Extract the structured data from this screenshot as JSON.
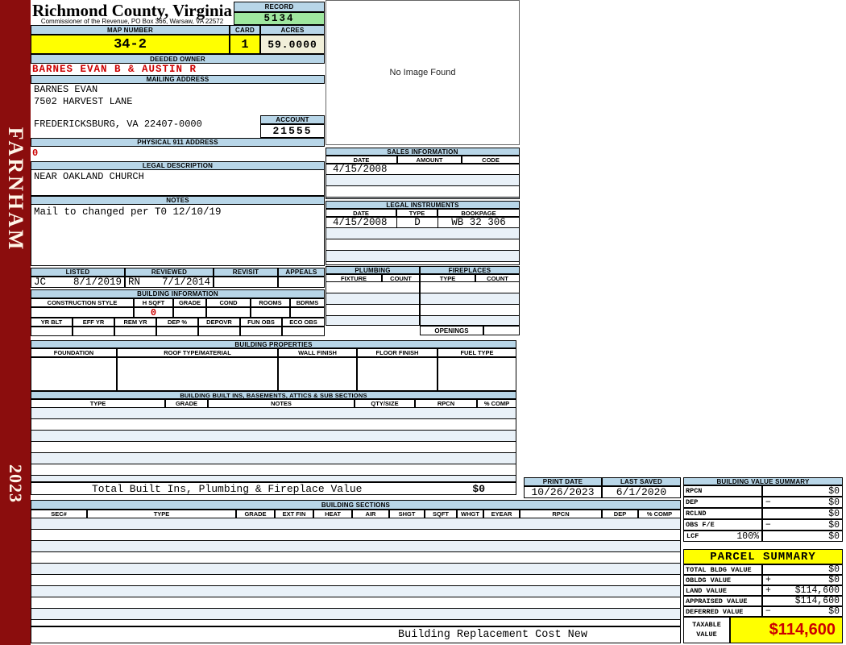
{
  "county": {
    "title": "Richmond County, Virginia",
    "subtitle": "Commissioner of the Revenue, PO Box 366, Warsaw, VA 22572"
  },
  "sidebar": {
    "district": "FARNHAM",
    "year": "2023"
  },
  "record": {
    "label": "RECORD",
    "value": "5134"
  },
  "map": {
    "label": "MAP NUMBER",
    "value": "34-2"
  },
  "card": {
    "label": "CARD",
    "value": "1"
  },
  "acres": {
    "label": "ACRES",
    "value": "59.0000"
  },
  "owner": {
    "label": "DEEDED OWNER",
    "value": "BARNES EVAN B & AUSTIN R"
  },
  "mailing": {
    "label": "MAILING ADDRESS",
    "line1": "BARNES EVAN",
    "line2": "7502 HARVEST LANE",
    "line3": "FREDERICKSBURG, VA 22407-0000"
  },
  "account": {
    "label": "ACCOUNT",
    "value": "21555"
  },
  "physical911": {
    "label": "PHYSICAL 911 ADDRESS",
    "value": "0"
  },
  "legal_description": {
    "label": "LEGAL DESCRIPTION",
    "value": "NEAR OAKLAND CHURCH"
  },
  "notes": {
    "label": "NOTES",
    "value": "Mail to changed per T0 12/10/19"
  },
  "review": {
    "headers": [
      "LISTED",
      "REVIEWED",
      "REVISIT",
      "APPEALS"
    ],
    "listed_by": "JC",
    "listed_date": "8/1/2019",
    "reviewed_by": "RN",
    "reviewed_date": "7/1/2014"
  },
  "building_information": {
    "label": "BUILDING INFORMATION",
    "row1_headers": [
      "CONSTRUCTION STYLE",
      "H SQFT",
      "GRADE",
      "COND",
      "ROOMS",
      "BDRMS"
    ],
    "h_sqft_value": "0",
    "row2_headers": [
      "YR BLT",
      "EFF YR",
      "REM YR",
      "DEP %",
      "DEPOVR",
      "FUN OBS",
      "ECO OBS"
    ]
  },
  "image": {
    "placeholder": "No Image Found"
  },
  "sales": {
    "label": "SALES INFORMATION",
    "headers": [
      "DATE",
      "AMOUNT",
      "CODE"
    ],
    "row": {
      "date": "4/15/2008",
      "amount": "",
      "code": ""
    }
  },
  "legal_instruments": {
    "label": "LEGAL INSTRUMENTS",
    "headers": [
      "DATE",
      "TYPE",
      "BOOKPAGE"
    ],
    "row": {
      "date": "4/15/2008",
      "type": "D",
      "bookpage": "WB 32 306"
    }
  },
  "plumbing": {
    "label": "PLUMBING",
    "headers": [
      "FIXTURE",
      "COUNT"
    ]
  },
  "fireplaces": {
    "label": "FIREPLACES",
    "headers": [
      "TYPE",
      "COUNT"
    ],
    "openings": "OPENINGS"
  },
  "building_properties": {
    "label": "BUILDING PROPERTIES",
    "headers": [
      "FOUNDATION",
      "ROOF TYPE/MATERIAL",
      "WALL FINISH",
      "FLOOR FINISH",
      "FUEL TYPE"
    ]
  },
  "built_ins": {
    "label": "BUILDING BUILT INS, BASEMENTS, ATTICS & SUB SECTIONS",
    "headers": [
      "TYPE",
      "GRADE",
      "NOTES",
      "QTY/SIZE",
      "RPCN",
      "% COMP"
    ],
    "total_label": "Total Built Ins, Plumbing & Fireplace Value",
    "total_value": "$0"
  },
  "print_date": {
    "label": "PRINT DATE",
    "value": "10/26/2023"
  },
  "last_saved": {
    "label": "LAST SAVED",
    "value": "6/1/2020"
  },
  "building_value_summary": {
    "label": "BUILDING VALUE SUMMARY",
    "rows": [
      {
        "label": "RPCN",
        "op": "",
        "value": "$0"
      },
      {
        "label": "DEP",
        "op": "−",
        "value": "$0"
      },
      {
        "label": "RCLND",
        "op": "",
        "value": "$0"
      },
      {
        "label": "OBS F/E",
        "op": "−",
        "value": "$0"
      },
      {
        "label": "LCF",
        "pct": "100%",
        "op": "",
        "value": "$0"
      }
    ]
  },
  "building_sections": {
    "label": "BUILDING SECTIONS",
    "headers": [
      "SEC#",
      "TYPE",
      "GRADE",
      "EXT FIN",
      "HEAT",
      "AIR",
      "SHGT",
      "SQFT",
      "WHGT",
      "EYEAR",
      "RPCN",
      "DEP",
      "% COMP"
    ]
  },
  "parcel_summary": {
    "label": "PARCEL SUMMARY",
    "rows": [
      {
        "label": "TOTAL BLDG VALUE",
        "op": "",
        "value": "$0"
      },
      {
        "label": "OBLDG VALUE",
        "op": "+",
        "value": "$0"
      },
      {
        "label": "LAND VALUE",
        "op": "+",
        "value": "$114,600"
      },
      {
        "label": "APPRAISED VALUE",
        "op": "",
        "value": "$114,600"
      },
      {
        "label": "DEFERRED VALUE",
        "op": "−",
        "value": "$0"
      }
    ],
    "taxable_label": "TAXABLE VALUE",
    "taxable_value": "$114,600"
  },
  "footer": {
    "label": "Building Replacement Cost New"
  },
  "colors": {
    "band_blue": "#B8D6E8",
    "record_green": "#9FE79F",
    "acres_cream": "#F1EFD9",
    "accent_yellow": "#FFFF00",
    "alert_red": "#CC0000",
    "sidebar_red": "#8B0D0D"
  }
}
